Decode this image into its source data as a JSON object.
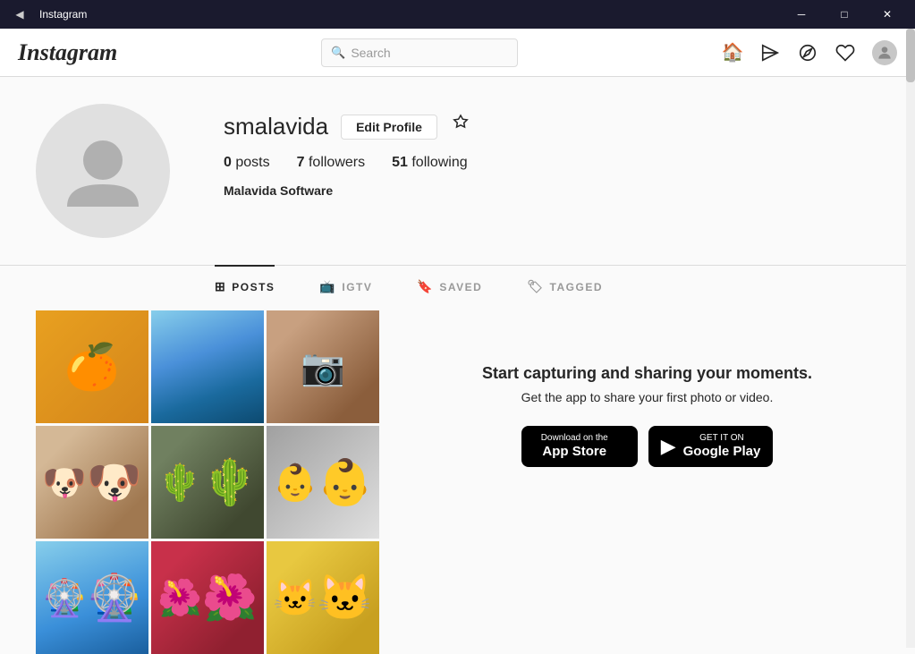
{
  "titlebar": {
    "back_icon": "◀",
    "title": "Instagram",
    "minimize_icon": "─",
    "maximize_icon": "□",
    "close_icon": "✕"
  },
  "navbar": {
    "logo": "Instagram",
    "search_placeholder": "Search",
    "home_icon": "⌂",
    "send_icon": "▷",
    "explore_icon": "◎",
    "heart_icon": "♡"
  },
  "profile": {
    "username": "smalavida",
    "edit_button": "Edit Profile",
    "stats": {
      "posts_count": "0",
      "posts_label": "posts",
      "followers_count": "7",
      "followers_label": "followers",
      "following_count": "51",
      "following_label": "following"
    },
    "display_name": "Malavida Software"
  },
  "tabs": [
    {
      "id": "posts",
      "label": "POSTS",
      "icon": "⊞",
      "active": true
    },
    {
      "id": "igtv",
      "label": "IGTV",
      "icon": "📺"
    },
    {
      "id": "saved",
      "label": "SAVED",
      "icon": "🔖"
    },
    {
      "id": "tagged",
      "label": "TAGGED",
      "icon": "🏷"
    }
  ],
  "cta": {
    "title": "Start capturing and sharing your moments.",
    "subtitle": "Get the app to share your first photo or video.",
    "appstore_small": "Download on the",
    "appstore_big": "App Store",
    "googleplay_small": "GET IT ON",
    "googleplay_big": "Google Play"
  },
  "photos": [
    {
      "id": 1,
      "cls": "pc1",
      "alt": "oranges"
    },
    {
      "id": 2,
      "cls": "pc2",
      "alt": "ocean"
    },
    {
      "id": 3,
      "cls": "pc3",
      "alt": "photos"
    },
    {
      "id": 4,
      "cls": "pc4",
      "alt": "dog"
    },
    {
      "id": 5,
      "cls": "pc5",
      "alt": "cactus"
    },
    {
      "id": 6,
      "cls": "pc6",
      "alt": "baby"
    },
    {
      "id": 7,
      "cls": "pc7",
      "alt": "ferris wheel"
    },
    {
      "id": 8,
      "cls": "pc8",
      "alt": "flowers"
    },
    {
      "id": 9,
      "cls": "pc9",
      "alt": "cat"
    }
  ]
}
